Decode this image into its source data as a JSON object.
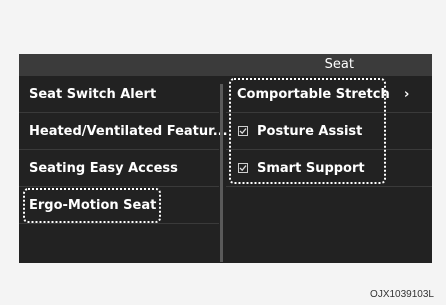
{
  "header": {
    "title": "Seat"
  },
  "left_menu": {
    "items": [
      {
        "label": "Seat Switch Alert"
      },
      {
        "label": "Heated/Ventilated Featur..."
      },
      {
        "label": "Seating Easy Access"
      },
      {
        "label": "Ergo-Motion Seat"
      }
    ]
  },
  "right_menu": {
    "items": [
      {
        "label": "Comportable Stretch",
        "chevron": "›"
      },
      {
        "label": "Posture Assist",
        "checked": true
      },
      {
        "label": "Smart Support",
        "checked": true
      }
    ]
  },
  "figure_code": "OJX1039103L",
  "colors": {
    "background": "#222222",
    "header": "#3b3b3b",
    "text": "#ffffff",
    "highlight_outline": "#ffffff"
  }
}
